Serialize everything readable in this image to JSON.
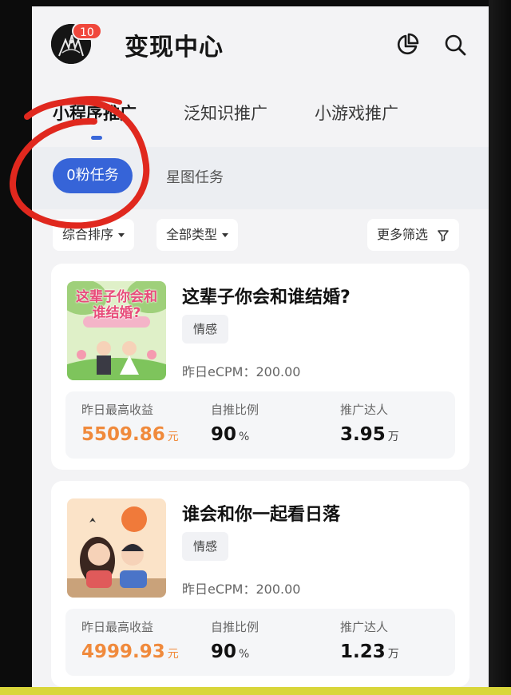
{
  "header": {
    "title": "变现中心",
    "badge_count": "10"
  },
  "tabs": [
    {
      "label": "小程序推广",
      "active": true
    },
    {
      "label": "泛知识推广",
      "active": false
    },
    {
      "label": "小游戏推广",
      "active": false
    }
  ],
  "subtabs": [
    {
      "label": "0粉任务",
      "active": true
    },
    {
      "label": "星图任务",
      "active": false
    }
  ],
  "filters": {
    "sort": "综合排序",
    "type": "全部类型",
    "more": "更多筛选"
  },
  "cards": [
    {
      "title": "这辈子你会和谁结婚?",
      "thumb_text": "这辈子你会和谁结婚?",
      "tag": "情感",
      "ecpm": "昨日eCPM：200.00",
      "stats": [
        {
          "label": "昨日最高收益",
          "value": "5509.86",
          "unit": "元"
        },
        {
          "label": "自推比例",
          "value": "90",
          "unit": "%"
        },
        {
          "label": "推广达人",
          "value": "3.95",
          "unit": "万"
        }
      ]
    },
    {
      "title": "谁会和你一起看日落",
      "tag": "情感",
      "ecpm": "昨日eCPM：200.00",
      "stats": [
        {
          "label": "昨日最高收益",
          "value": "4999.93",
          "unit": "元"
        },
        {
          "label": "自推比例",
          "value": "90",
          "unit": "%"
        },
        {
          "label": "推广达人",
          "value": "1.23",
          "unit": "万"
        }
      ]
    }
  ],
  "colors": {
    "accent": "#3664d8",
    "badge": "#f0473c",
    "earnings": "#f08a3c",
    "annotation": "#e0281e"
  },
  "icons": [
    "pie-chart-icon",
    "search-icon",
    "filter-icon"
  ]
}
